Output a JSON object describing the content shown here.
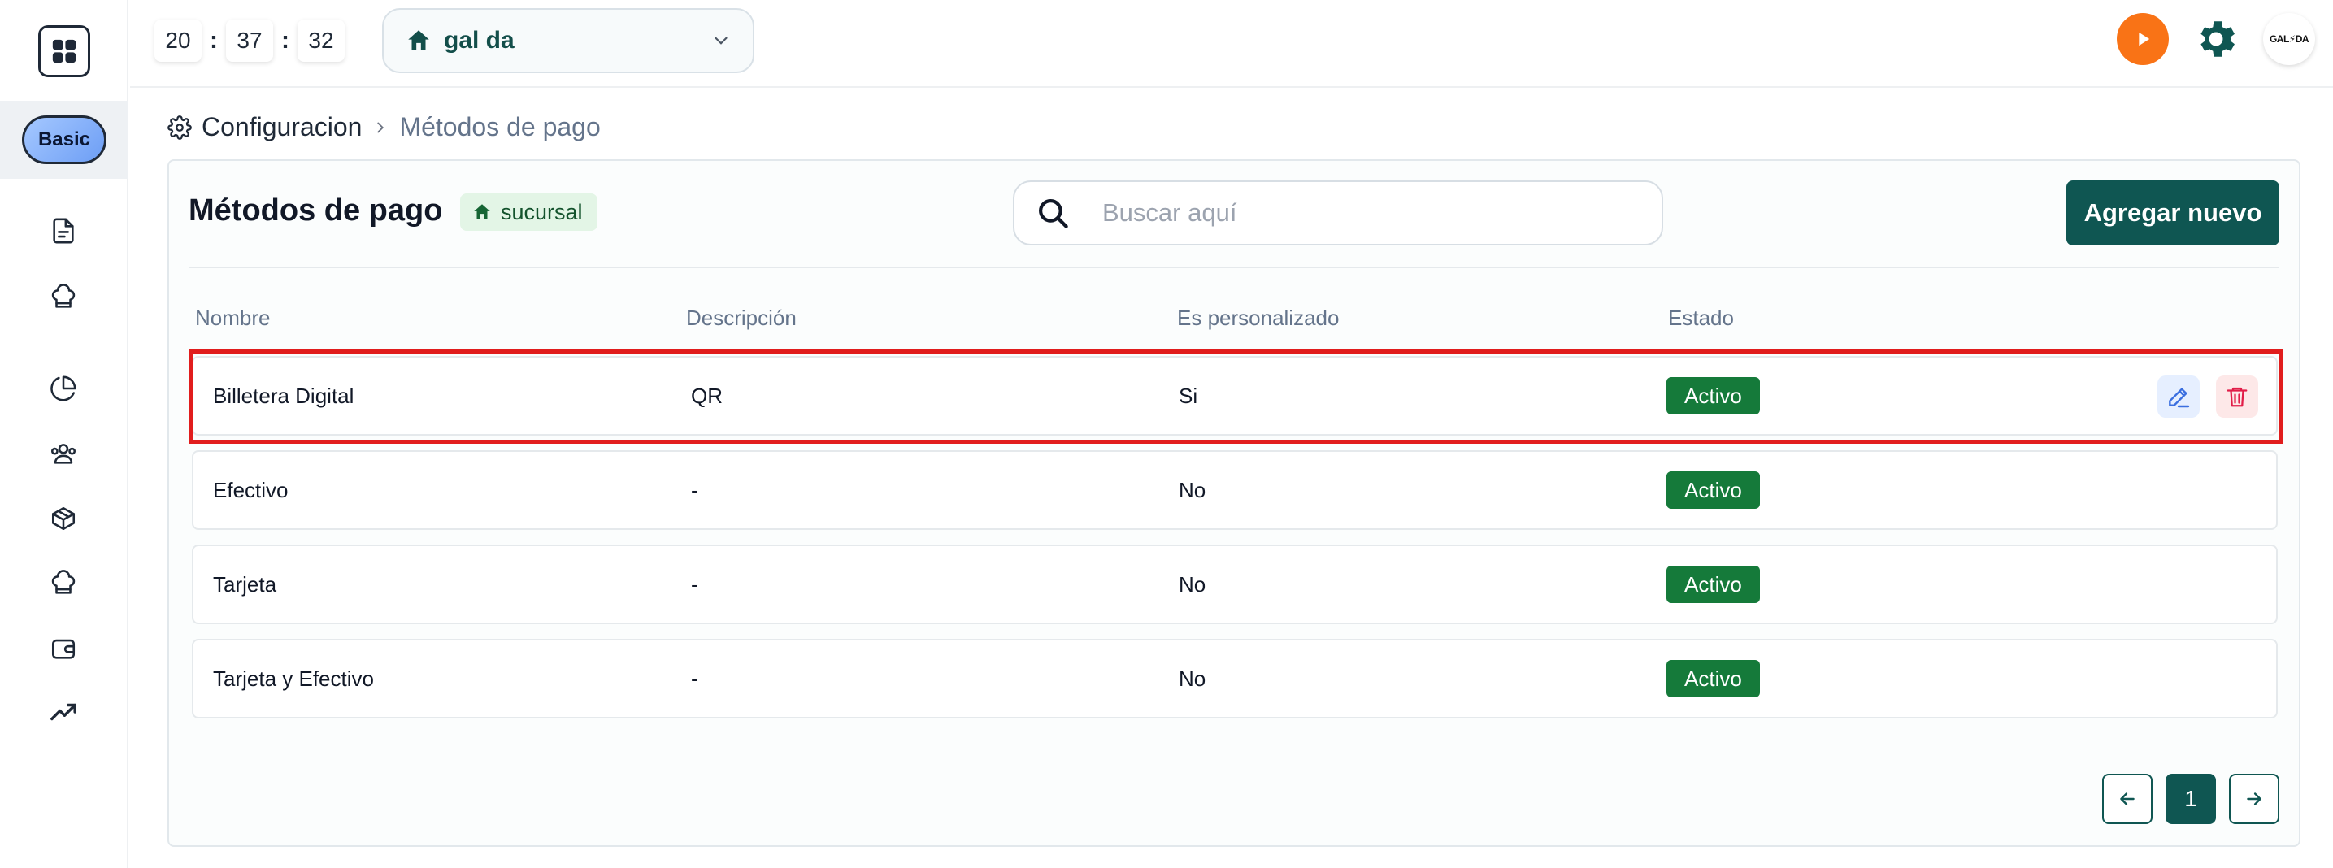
{
  "header": {
    "clock": {
      "hours": "20",
      "minutes": "37",
      "seconds": "32",
      "separator": ":"
    },
    "store_select": {
      "value": "gal da",
      "icon": "home-icon"
    },
    "logo_text": "GAL⚡DA"
  },
  "sidebar": {
    "plan_label": "Basic",
    "icons": [
      "document-icon",
      "chef-hat-icon",
      "pie-chart-icon",
      "users-icon",
      "box-icon",
      "chef-hat-icon",
      "wallet-icon",
      "trending-up-icon"
    ]
  },
  "breadcrumb": {
    "root": "Configuracion",
    "current": "Métodos de pago"
  },
  "page": {
    "title": "Métodos de pago",
    "tag": "sucursal",
    "search_placeholder": "Buscar aquí",
    "add_button": "Agregar nuevo"
  },
  "table": {
    "columns": [
      "Nombre",
      "Descripción",
      "Es personalizado",
      "Estado"
    ],
    "rows": [
      {
        "nombre": "Billetera Digital",
        "descripcion": "QR",
        "personalizado": "Si",
        "estado": "Activo"
      },
      {
        "nombre": "Efectivo",
        "descripcion": "-",
        "personalizado": "No",
        "estado": "Activo"
      },
      {
        "nombre": "Tarjeta",
        "descripcion": "-",
        "personalizado": "No",
        "estado": "Activo"
      },
      {
        "nombre": "Tarjeta y Efectivo",
        "descripcion": "-",
        "personalizado": "No",
        "estado": "Activo"
      }
    ]
  },
  "pagination": {
    "current_page": "1"
  },
  "colors": {
    "primary": "#0f5652",
    "active_badge": "#157a3a",
    "accent_orange": "#f97316",
    "highlight": "#e11d1d"
  }
}
